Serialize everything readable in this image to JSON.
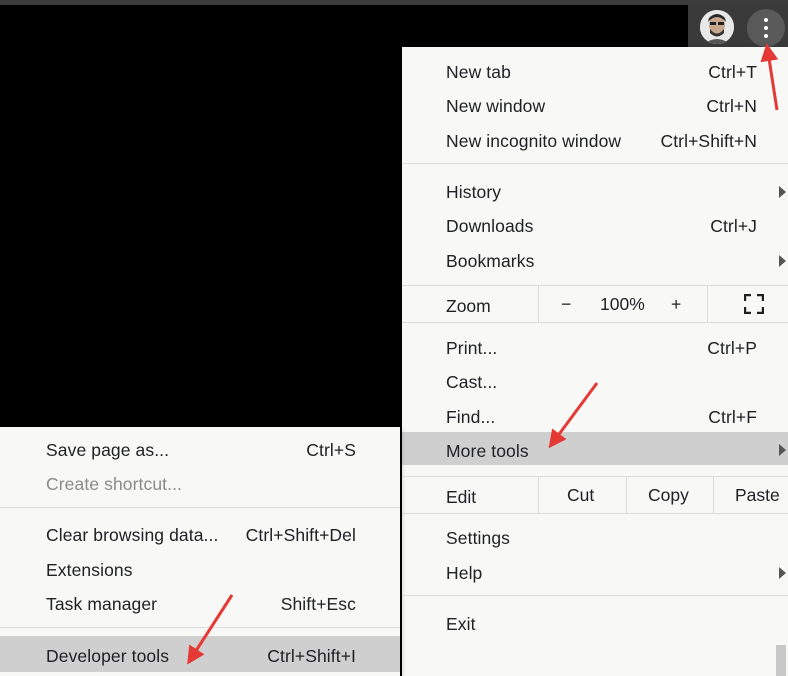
{
  "main_menu": {
    "new_tab": {
      "label": "New tab",
      "shortcut": "Ctrl+T"
    },
    "new_window": {
      "label": "New window",
      "shortcut": "Ctrl+N"
    },
    "new_incognito": {
      "label": "New incognito window",
      "shortcut": "Ctrl+Shift+N"
    },
    "history": {
      "label": "History"
    },
    "downloads": {
      "label": "Downloads",
      "shortcut": "Ctrl+J"
    },
    "bookmarks": {
      "label": "Bookmarks"
    },
    "zoom": {
      "label": "Zoom",
      "minus": "−",
      "level": "100%",
      "plus": "+"
    },
    "print": {
      "label": "Print...",
      "shortcut": "Ctrl+P"
    },
    "cast": {
      "label": "Cast..."
    },
    "find": {
      "label": "Find...",
      "shortcut": "Ctrl+F"
    },
    "more_tools": {
      "label": "More tools"
    },
    "edit": {
      "label": "Edit",
      "cut": "Cut",
      "copy": "Copy",
      "paste": "Paste"
    },
    "settings": {
      "label": "Settings"
    },
    "help": {
      "label": "Help"
    },
    "exit": {
      "label": "Exit"
    }
  },
  "sub_menu": {
    "save_page": {
      "label": "Save page as...",
      "shortcut": "Ctrl+S"
    },
    "create_shortcut": {
      "label": "Create shortcut..."
    },
    "clear_data": {
      "label": "Clear browsing data...",
      "shortcut": "Ctrl+Shift+Del"
    },
    "extensions": {
      "label": "Extensions"
    },
    "task_manager": {
      "label": "Task manager",
      "shortcut": "Shift+Esc"
    },
    "developer_tools": {
      "label": "Developer tools",
      "shortcut": "Ctrl+Shift+I"
    }
  },
  "icons": {
    "menu": "three-dots-vertical-icon",
    "fullscreen": "fullscreen-icon",
    "profile": "avatar"
  },
  "colors": {
    "menu_bg": "#f8f8f7",
    "highlight": "#cfcfcf",
    "annotation_arrow": "#e53935"
  }
}
